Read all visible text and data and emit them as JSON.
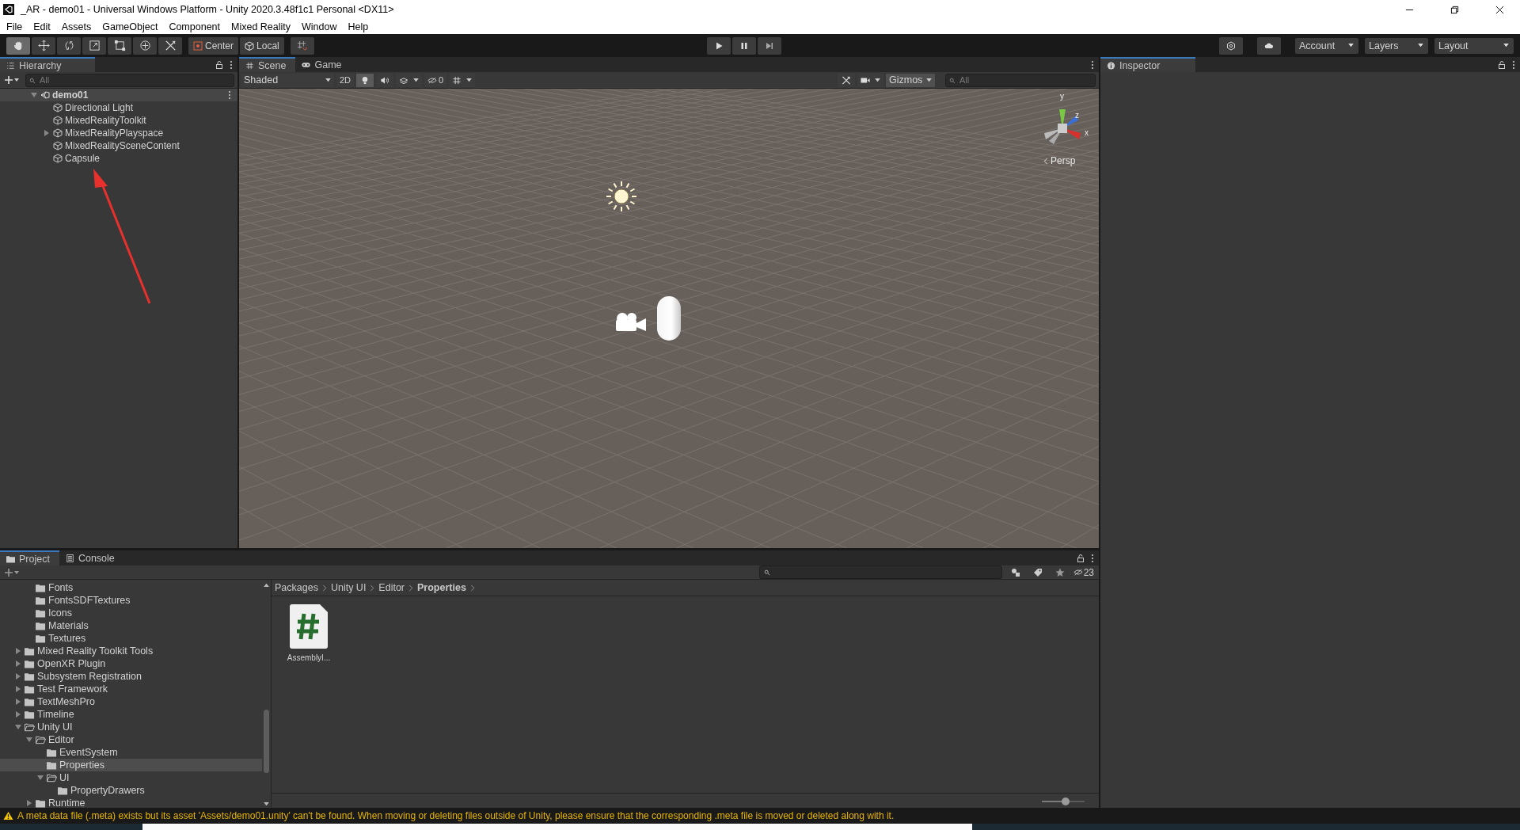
{
  "window": {
    "title": "_AR - demo01 - Universal Windows Platform - Unity 2020.3.48f1c1 Personal <DX11>"
  },
  "menu": [
    "File",
    "Edit",
    "Assets",
    "GameObject",
    "Component",
    "Mixed Reality",
    "Window",
    "Help"
  ],
  "toolbar": {
    "tools": [
      {
        "kind": "hand",
        "selected": true
      },
      {
        "kind": "move",
        "selected": false
      },
      {
        "kind": "rotate",
        "selected": false
      },
      {
        "kind": "scale",
        "selected": false
      },
      {
        "kind": "rect",
        "selected": false
      },
      {
        "kind": "transform",
        "selected": false
      },
      {
        "kind": "custom",
        "selected": false
      }
    ],
    "pivot": [
      {
        "kind": "center",
        "label": "Center"
      },
      {
        "kind": "local",
        "label": "Local"
      }
    ],
    "playback": [
      {
        "kind": "play"
      },
      {
        "kind": "pause"
      },
      {
        "kind": "step"
      }
    ],
    "menus": [
      "Account",
      "Layers",
      "Layout"
    ]
  },
  "hierarchy": {
    "tab": "Hierarchy",
    "search": {
      "placeholder": "All"
    },
    "scene": {
      "label": "demo01",
      "expanded": true,
      "children": [
        {
          "label": "Directional Light"
        },
        {
          "label": "MixedRealityToolkit"
        },
        {
          "label": "MixedRealityPlayspace",
          "expanded": false
        },
        {
          "label": "MixedRealitySceneContent"
        },
        {
          "label": "Capsule"
        }
      ]
    }
  },
  "scene_view": {
    "tabs": [
      {
        "label": "Scene",
        "kind": "scene",
        "selected": true
      },
      {
        "label": "Game",
        "kind": "game",
        "selected": false
      }
    ],
    "shading": "Shaded",
    "mode_2d": "2D",
    "lighting_on": true,
    "hidden_count": "0",
    "gizmos": "Gizmos",
    "search": {
      "placeholder": "All"
    },
    "axes": [
      "y",
      "z",
      "x"
    ],
    "projection": "Persp"
  },
  "inspector": {
    "tab": "Inspector"
  },
  "project": {
    "tabs": [
      {
        "label": "Project",
        "kind": "project",
        "selected": true
      },
      {
        "label": "Console",
        "kind": "console",
        "selected": false
      }
    ],
    "hidden_count": "23",
    "tree": {
      "continued": [
        {
          "label": "Fonts"
        },
        {
          "label": "FontsSDFTextures"
        },
        {
          "label": "Icons"
        },
        {
          "label": "Materials"
        },
        {
          "label": "Textures"
        }
      ],
      "items": [
        {
          "label": "Mixed Reality Toolkit Tools",
          "expanded": false,
          "selected": false
        },
        {
          "label": "OpenXR Plugin",
          "expanded": false,
          "selected": false
        },
        {
          "label": "Subsystem Registration",
          "expanded": false,
          "selected": false
        },
        {
          "label": "Test Framework",
          "expanded": false,
          "selected": false
        },
        {
          "label": "TextMeshPro",
          "expanded": false,
          "selected": false
        },
        {
          "label": "Timeline",
          "expanded": false,
          "selected": false
        },
        {
          "label": "Unity UI",
          "expanded": true,
          "selected": false,
          "children": [
            {
              "label": "Editor",
              "expanded": true,
              "selected": false,
              "children": [
                {
                  "label": "EventSystem",
                  "selected": false
                },
                {
                  "label": "Properties",
                  "selected": true
                },
                {
                  "label": "UI",
                  "expanded": true,
                  "selected": false,
                  "children": [
                    {
                      "label": "PropertyDrawers",
                      "selected": false
                    }
                  ]
                }
              ]
            },
            {
              "label": "Runtime",
              "expanded": false,
              "selected": false
            }
          ]
        }
      ]
    },
    "breadcrumb": [
      "Packages",
      "Unity UI",
      "Editor",
      "Properties"
    ],
    "assets": [
      {
        "label": "AssemblyI...",
        "kind": "script"
      }
    ],
    "icon_size": {
      "level": 0.55
    }
  },
  "status_bar": {
    "message": "A meta data file (.meta) exists but its asset 'Assets/demo01.unity' can't be found. When moving or deleting files outside of Unity, please ensure that the corresponding .meta file is moved or deleted along with it."
  }
}
